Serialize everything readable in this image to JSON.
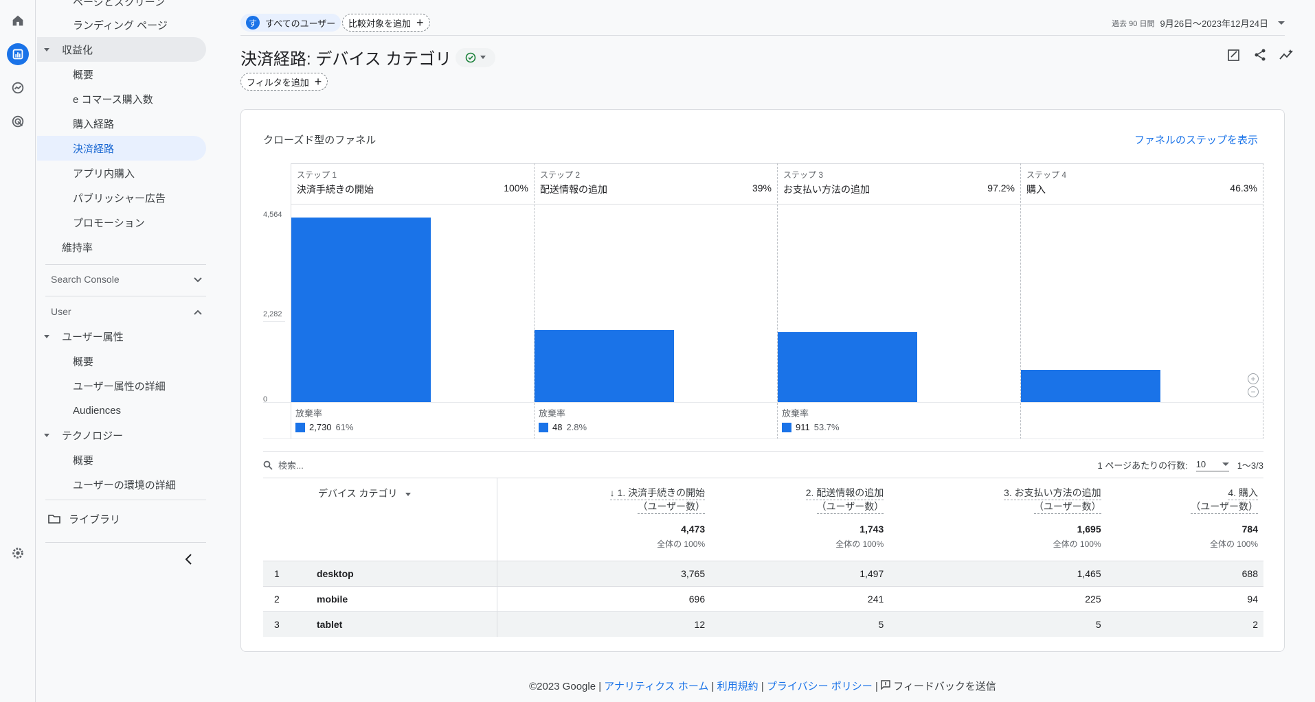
{
  "rail": {
    "icons": [
      "home-icon",
      "reports-icon",
      "explore-icon",
      "advertising-icon",
      "settings-icon"
    ]
  },
  "nav": {
    "items": [
      {
        "label": "ページとスクリーン",
        "level": 2
      },
      {
        "label": "ランディング ページ",
        "level": 2
      },
      {
        "label": "収益化",
        "level": 1,
        "group": true
      },
      {
        "label": "概要",
        "level": 2
      },
      {
        "label": "e コマース購入数",
        "level": 2
      },
      {
        "label": "購入経路",
        "level": 2
      },
      {
        "label": "決済経路",
        "level": 2,
        "selected": true
      },
      {
        "label": "アプリ内購入",
        "level": 2
      },
      {
        "label": "パブリッシャー広告",
        "level": 2
      },
      {
        "label": "プロモーション",
        "level": 2
      },
      {
        "label": "維持率",
        "level": 1
      }
    ],
    "search_console": "Search Console",
    "user_section": "User",
    "user_items": [
      {
        "label": "ユーザー属性",
        "level": 1
      },
      {
        "label": "概要",
        "level": 2
      },
      {
        "label": "ユーザー属性の詳細",
        "level": 2
      },
      {
        "label": "Audiences",
        "level": 2
      },
      {
        "label": "テクノロジー",
        "level": 1
      },
      {
        "label": "概要",
        "level": 2
      },
      {
        "label": "ユーザーの環境の詳細",
        "level": 2
      }
    ],
    "library": "ライブラリ"
  },
  "topbar": {
    "user_chip_initial": "す",
    "user_chip": "すべてのユーザー",
    "add_compare": "比較対象を追加",
    "date_prefix": "過去 90 日間",
    "date_range": "9月26日～2023年12月24日"
  },
  "page": {
    "title": "決済経路: デバイス カテゴリ",
    "add_filter": "フィルタを追加"
  },
  "card": {
    "title": "クローズド型のファネル",
    "link": "ファネルのステップを表示",
    "axis": [
      "4,564",
      "2,282",
      "0"
    ],
    "steps": [
      {
        "num": "ステップ 1",
        "name": "決済手続きの開始",
        "pct": "100%",
        "drop_label": "放棄率",
        "drop_value": "2,730",
        "drop_pct": "61%"
      },
      {
        "num": "ステップ 2",
        "name": "配送情報の追加",
        "pct": "39%",
        "drop_label": "放棄率",
        "drop_value": "48",
        "drop_pct": "2.8%"
      },
      {
        "num": "ステップ 3",
        "name": "お支払い方法の追加",
        "pct": "97.2%",
        "drop_label": "放棄率",
        "drop_value": "911",
        "drop_pct": "53.7%"
      },
      {
        "num": "ステップ 4",
        "name": "購入",
        "pct": "46.3%"
      }
    ]
  },
  "chart_data": {
    "type": "bar",
    "categories": [
      "決済手続きの開始",
      "配送情報の追加",
      "お支払い方法の追加",
      "購入"
    ],
    "values": [
      4473,
      1743,
      1695,
      784
    ],
    "ylim": [
      0,
      4564
    ],
    "yticks": [
      "4,564",
      "2,282",
      "0"
    ]
  },
  "table": {
    "search_placeholder": "検索...",
    "rows_per_page_label": "1 ページあたりの行数:",
    "rows_per_page": "10",
    "pagination": "1～3/3",
    "dim_header": "デバイス カテゴリ",
    "columns": [
      {
        "line1": "↓ 1. 決済手続きの開始",
        "line2": "（ユーザー数）",
        "total": "4,473",
        "total_sub": "全体の 100%"
      },
      {
        "line1": "2. 配送情報の追加",
        "line2": "（ユーザー数）",
        "total": "1,743",
        "total_sub": "全体の 100%"
      },
      {
        "line1": "3. お支払い方法の追加",
        "line2": "（ユーザー数）",
        "total": "1,695",
        "total_sub": "全体の 100%"
      },
      {
        "line1": "4. 購入",
        "line2": "（ユーザー数）",
        "total": "784",
        "total_sub": "全体の 100%"
      }
    ],
    "rows": [
      {
        "idx": "1",
        "dim": "desktop",
        "v": [
          "3,765",
          "1,497",
          "1,465",
          "688"
        ]
      },
      {
        "idx": "2",
        "dim": "mobile",
        "v": [
          "696",
          "241",
          "225",
          "94"
        ]
      },
      {
        "idx": "3",
        "dim": "tablet",
        "v": [
          "12",
          "5",
          "5",
          "2"
        ]
      }
    ]
  },
  "footer": {
    "copyright": "©2023 Google |",
    "link1": "アナリティクス ホーム",
    "sep1": "|",
    "link2": "利用規約",
    "sep2": "|",
    "link3": "プライバシー ポリシー",
    "sep3": "|",
    "feedback": "フィードバックを送信"
  },
  "colors": {
    "accent": "#1a73e8",
    "bar": "#1a73e8"
  }
}
